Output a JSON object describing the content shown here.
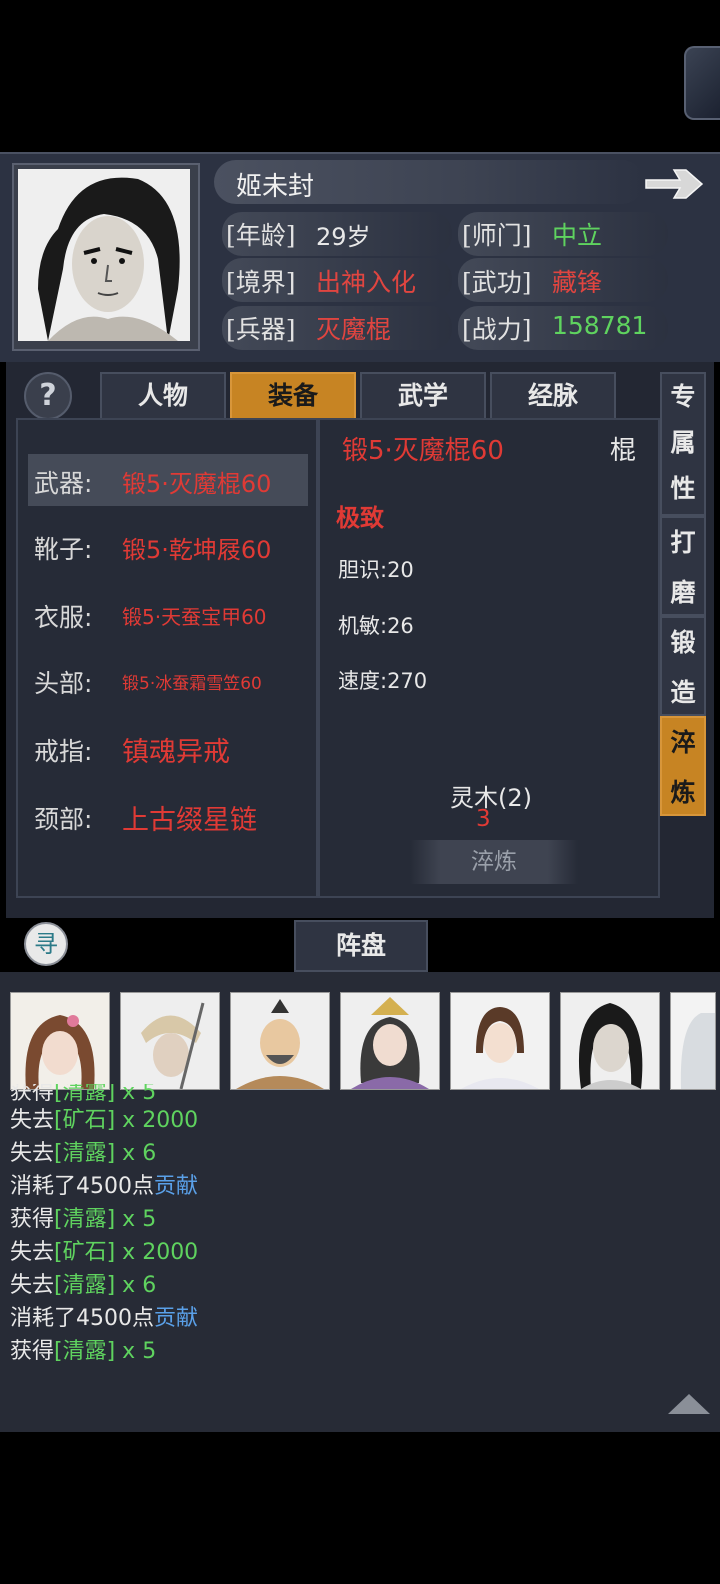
{
  "character": {
    "name": "姬未封",
    "age_label": "[年龄]",
    "age_value": "29岁",
    "sect_label": "[师门]",
    "sect_value": "中立",
    "realm_label": "[境界]",
    "realm_value": "出神入化",
    "skill_label": "[武功]",
    "skill_value": "藏锋",
    "weapon_label": "[兵器]",
    "weapon_value": "灭魔棍",
    "power_label": "[战力]",
    "power_value": "158781"
  },
  "help_symbol": "?",
  "tabs": [
    {
      "label": "人物"
    },
    {
      "label": "装备"
    },
    {
      "label": "武学"
    },
    {
      "label": "经脉"
    }
  ],
  "side_tabs": [
    {
      "label": "专属性"
    },
    {
      "label": "打磨"
    },
    {
      "label": "锻造"
    },
    {
      "label": "淬炼"
    }
  ],
  "slots": [
    {
      "label": "武器:",
      "value": "锻5·灭魔棍60"
    },
    {
      "label": "靴子:",
      "value": "锻5·乾坤屐60"
    },
    {
      "label": "衣服:",
      "value": "锻5·天蚕宝甲60"
    },
    {
      "label": "头部:",
      "value": "锻5·冰蚕霜雪笠60"
    },
    {
      "label": "戒指:",
      "value": "镇魂异戒"
    },
    {
      "label": "颈部:",
      "value": "上古缀星链"
    }
  ],
  "item": {
    "title": "锻5·灭魔棍60",
    "type": "棍",
    "quality": "极致",
    "stats": [
      "胆识:20",
      "机敏:26",
      "速度:270"
    ],
    "material_name": "灵木(2)",
    "material_count": "3",
    "refine_label": "淬炼"
  },
  "xun_symbol": "寻",
  "formation_label": "阵盘",
  "log": [
    [
      "获得",
      "[清露]",
      " x 5",
      ""
    ],
    [
      "失去",
      "[矿石]",
      " x 2000",
      ""
    ],
    [
      "失去",
      "[清露]",
      " x 6",
      ""
    ],
    [
      "消耗了4500点",
      "",
      "",
      "贡献"
    ],
    [
      "获得",
      "[清露]",
      " x 5",
      ""
    ],
    [
      "失去",
      "[矿石]",
      " x 2000",
      ""
    ],
    [
      "失去",
      "[清露]",
      " x 6",
      ""
    ],
    [
      "消耗了4500点",
      "",
      "",
      "贡献"
    ],
    [
      "获得",
      "[清露]",
      " x 5",
      ""
    ]
  ],
  "colors": {
    "accent_orange": "#c78423",
    "red_text": "#e03a35",
    "green_text": "#5fd35f",
    "blue_text": "#5aa0e8"
  },
  "icons": [
    "book-icon",
    "arrow-right-icon",
    "help-icon",
    "xun-icon",
    "scroll-up-icon"
  ]
}
